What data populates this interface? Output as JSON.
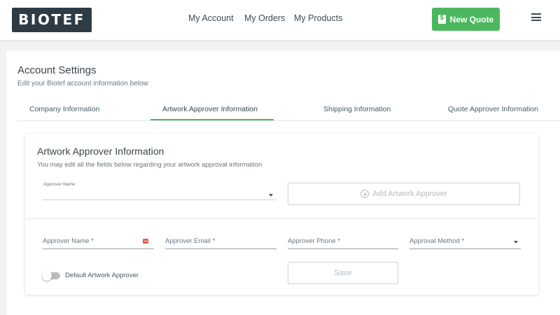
{
  "header": {
    "logo_text": "BIOTEF",
    "nav": {
      "account": "My Account",
      "orders": "My Orders",
      "products": "My Products"
    },
    "new_quote_label": "New Quote",
    "colors": {
      "brand_dark": "#2f3b44",
      "accent_green": "#4cb85e"
    }
  },
  "page": {
    "title": "Account Settings",
    "subtitle": "Edit your Biotef account information below"
  },
  "tabs": [
    {
      "label": "Company Information",
      "active": false
    },
    {
      "label": "Artwork Approver Information",
      "active": true
    },
    {
      "label": "Shipping Information",
      "active": false
    },
    {
      "label": "Quote Approver Information",
      "active": false
    }
  ],
  "section": {
    "title": "Artwork Approver Information",
    "subtitle": "You may edit all the fields below regarding your artwork approval information",
    "approver_select_label": "Approver Name",
    "approver_select_value": "",
    "add_button_label": "Add Artwork Approver"
  },
  "form": {
    "name_label": "Approver Name *",
    "email_label": "Approver Email *",
    "phone_label": "Approver Phone *",
    "method_label": "Approval Method *",
    "default_toggle_label": "Default Artwork Approver",
    "default_toggle_on": false,
    "save_label": "Save"
  },
  "icons": {
    "new_quote": "dollar-document-icon",
    "menu": "hamburger-menu-icon",
    "add": "plus-circle-icon",
    "field_badge": "red-autofill-badge-icon",
    "dropdown": "caret-down-icon"
  }
}
